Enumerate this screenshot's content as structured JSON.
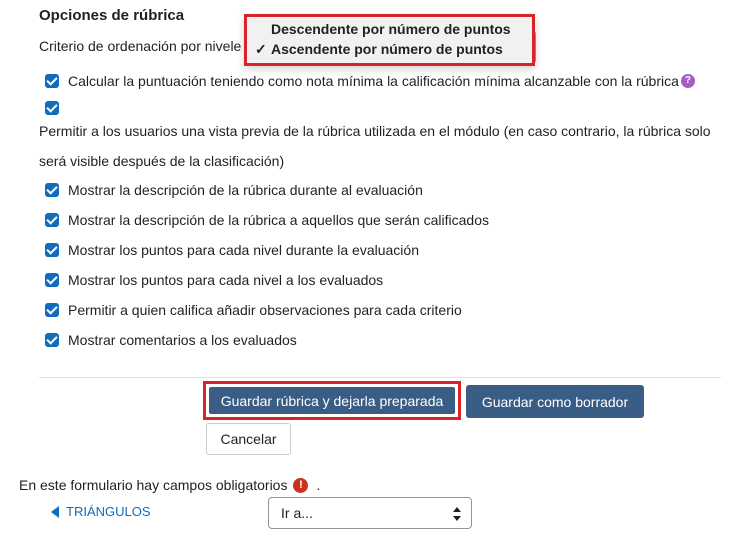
{
  "section": {
    "title": "Opciones de rúbrica"
  },
  "sort": {
    "label": "Criterio de ordenación por nivele",
    "options": [
      "Descendente por número de puntos",
      "Ascendente por número de puntos"
    ],
    "selected": "Ascendente por número de puntos",
    "check_mark": "✓"
  },
  "options": {
    "min_grade": "Calcular la puntuación teniendo como nota mínima la calificación mínima alcanzable con la rúbrica",
    "preview_text": "Permitir a los usuarios una vista previa de la rúbrica utilizada en el módulo (en caso contrario, la rúbrica solo será visible después de la clasificación)",
    "show_desc_eval": "Mostrar la descripción de la rúbrica durante al evaluación",
    "show_desc_graded": "Mostrar la descripción de la rúbrica a aquellos que serán calificados",
    "show_points_eval": "Mostrar los puntos para cada nivel durante la evaluación",
    "show_points_graded": "Mostrar los puntos para cada nivel a los evaluados",
    "allow_remarks": "Permitir a quien califica añadir observaciones para cada criterio",
    "show_comments": "Mostrar comentarios a los evaluados"
  },
  "buttons": {
    "save_ready": "Guardar rúbrica y dejarla preparada",
    "save_draft": "Guardar como borrador",
    "cancel": "Cancelar"
  },
  "footer": {
    "required_text": "En este formulario hay campos obligatorios",
    "required_suffix": ".",
    "required_icon": "!",
    "help_icon": "?",
    "prev_link": "TRIÁNGULOS",
    "jump_placeholder": "Ir a..."
  },
  "colors": {
    "accent": "#0f6cbf",
    "button": "#3a5d85",
    "highlight": "#d9232a",
    "help": "#a65ec5",
    "required": "#ca3120"
  }
}
